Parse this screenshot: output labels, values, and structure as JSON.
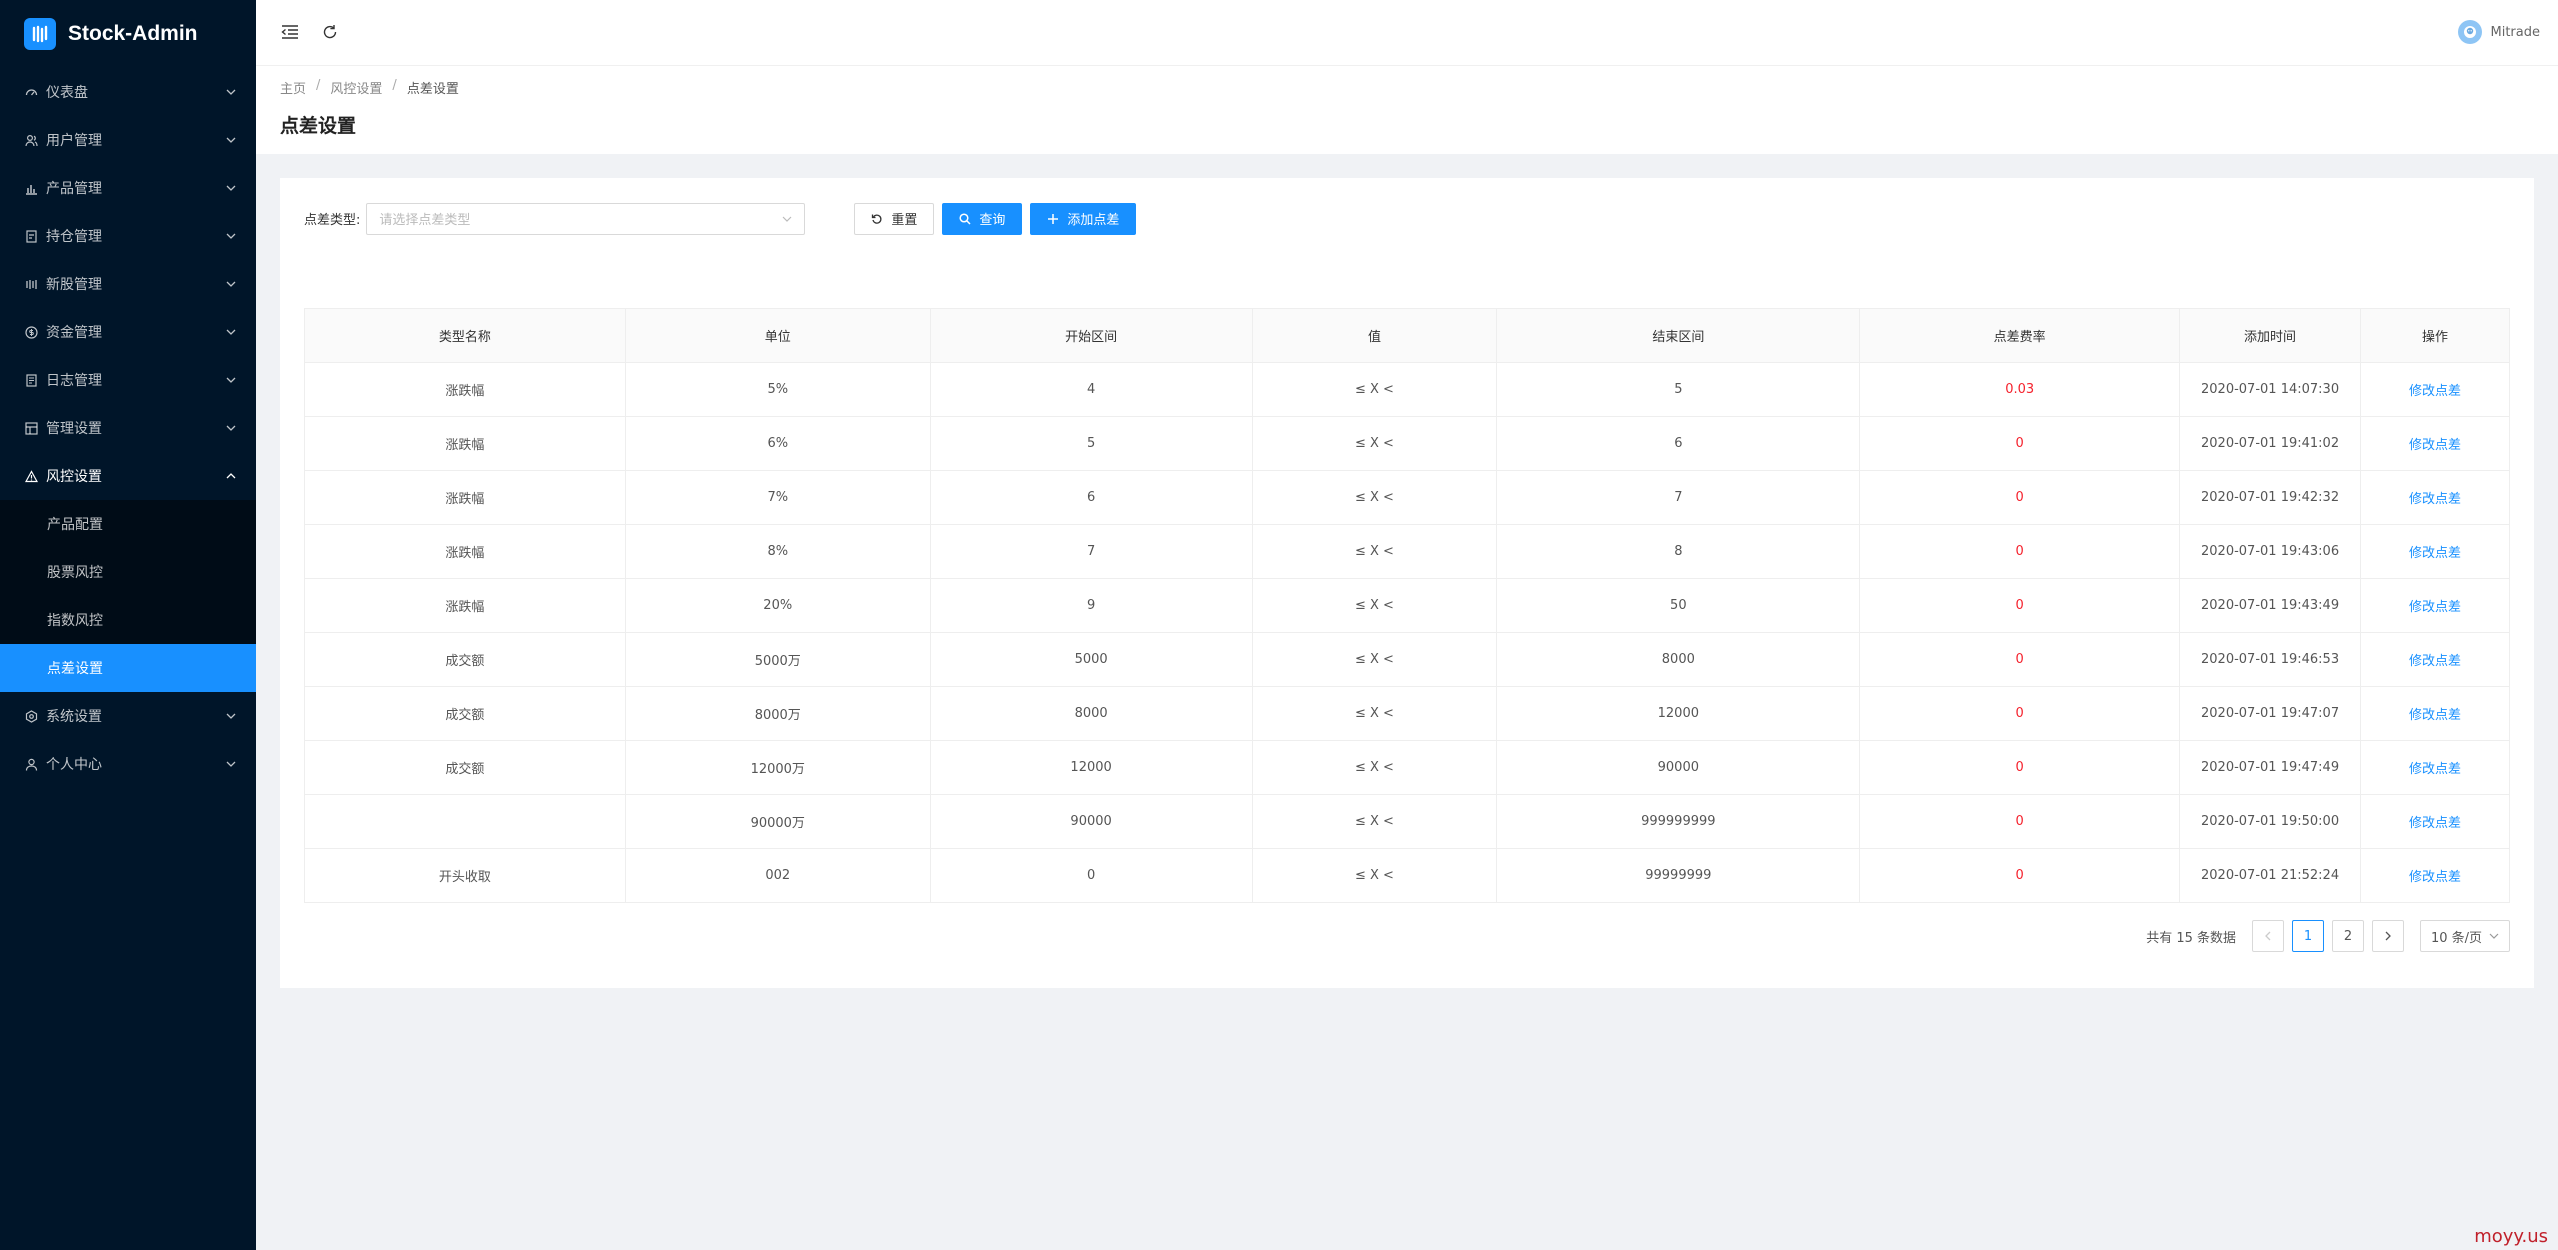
{
  "app": {
    "title": "Stock-Admin"
  },
  "sidebar": {
    "items": [
      {
        "label": "仪表盘",
        "icon": "dashboard-icon"
      },
      {
        "label": "用户管理",
        "icon": "users-icon"
      },
      {
        "label": "产品管理",
        "icon": "chart-icon"
      },
      {
        "label": "持仓管理",
        "icon": "position-icon"
      },
      {
        "label": "新股管理",
        "icon": "ipo-icon"
      },
      {
        "label": "资金管理",
        "icon": "money-icon"
      },
      {
        "label": "日志管理",
        "icon": "log-icon"
      },
      {
        "label": "管理设置",
        "icon": "admin-icon"
      },
      {
        "label": "风控设置",
        "icon": "warning-icon"
      },
      {
        "label": "系统设置",
        "icon": "settings-icon"
      },
      {
        "label": "个人中心",
        "icon": "user-icon"
      }
    ],
    "risk_sub": [
      {
        "label": "产品配置"
      },
      {
        "label": "股票风控"
      },
      {
        "label": "指数风控"
      },
      {
        "label": "点差设置"
      }
    ]
  },
  "header": {
    "username": "Mitrade"
  },
  "breadcrumb": {
    "home": "主页",
    "parent": "风控设置",
    "current": "点差设置"
  },
  "page": {
    "title": "点差设置"
  },
  "filter": {
    "label": "点差类型:",
    "placeholder": "请选择点差类型",
    "reset_label": "重置",
    "search_label": "查询",
    "add_label": "添加点差"
  },
  "table": {
    "headers": [
      "类型名称",
      "单位",
      "开始区间",
      "值",
      "结束区间",
      "点差费率",
      "添加时间",
      "操作"
    ],
    "rows": [
      {
        "type": "涨跌幅",
        "unit": "5%",
        "start": "4",
        "value": "≤ X <",
        "end": "5",
        "rate": "0.03",
        "time": "2020-07-01 14:07:30",
        "action": "修改点差"
      },
      {
        "type": "涨跌幅",
        "unit": "6%",
        "start": "5",
        "value": "≤ X <",
        "end": "6",
        "rate": "0",
        "time": "2020-07-01 19:41:02",
        "action": "修改点差"
      },
      {
        "type": "涨跌幅",
        "unit": "7%",
        "start": "6",
        "value": "≤ X <",
        "end": "7",
        "rate": "0",
        "time": "2020-07-01 19:42:32",
        "action": "修改点差"
      },
      {
        "type": "涨跌幅",
        "unit": "8%",
        "start": "7",
        "value": "≤ X <",
        "end": "8",
        "rate": "0",
        "time": "2020-07-01 19:43:06",
        "action": "修改点差"
      },
      {
        "type": "涨跌幅",
        "unit": "20%",
        "start": "9",
        "value": "≤ X <",
        "end": "50",
        "rate": "0",
        "time": "2020-07-01 19:43:49",
        "action": "修改点差"
      },
      {
        "type": "成交额",
        "unit": "5000万",
        "start": "5000",
        "value": "≤ X <",
        "end": "8000",
        "rate": "0",
        "time": "2020-07-01 19:46:53",
        "action": "修改点差"
      },
      {
        "type": "成交额",
        "unit": "8000万",
        "start": "8000",
        "value": "≤ X <",
        "end": "12000",
        "rate": "0",
        "time": "2020-07-01 19:47:07",
        "action": "修改点差"
      },
      {
        "type": "成交额",
        "unit": "12000万",
        "start": "12000",
        "value": "≤ X <",
        "end": "90000",
        "rate": "0",
        "time": "2020-07-01 19:47:49",
        "action": "修改点差"
      },
      {
        "type": "",
        "unit": "90000万",
        "start": "90000",
        "value": "≤ X <",
        "end": "999999999",
        "rate": "0",
        "time": "2020-07-01 19:50:00",
        "action": "修改点差"
      },
      {
        "type": "开头收取",
        "unit": "002",
        "start": "0",
        "value": "≤ X <",
        "end": "99999999",
        "rate": "0",
        "time": "2020-07-01 21:52:24",
        "action": "修改点差"
      }
    ]
  },
  "pagination": {
    "total_text": "共有 15 条数据",
    "pages": [
      "1",
      "2"
    ],
    "current": "1",
    "page_size": "10 条/页"
  },
  "watermark": "moyy.us",
  "colors": {
    "sidebar_bg": "#001529",
    "accent": "#1890ff",
    "rate_red": "#f5222d"
  }
}
